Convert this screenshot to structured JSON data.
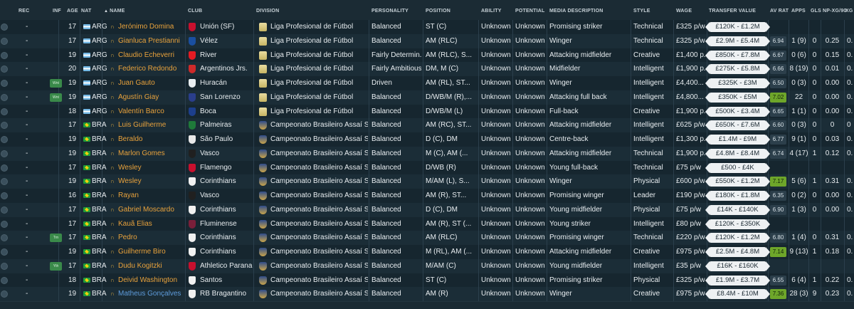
{
  "headers": {
    "rec": "REC",
    "inf": "INF",
    "age": "AGE",
    "nat": "NAT",
    "name": "NAME",
    "club": "CLUB",
    "division": "DIVISION",
    "personality": "PERSONALITY",
    "position": "POSITION",
    "ability": "ABILITY",
    "potential": "POTENTIAL",
    "media": "MEDIA DESCRIPTION",
    "style": "STYLE",
    "wage": "WAGE",
    "transfer_value": "TRANSFER VALUE",
    "av_rat": "AV RAT",
    "apps": "APPS",
    "gls": "GLS",
    "npxg": "NP-XG/90",
    "xg": "XG"
  },
  "colors": {
    "background": "#1a2a33",
    "name_orange": "#e8a23c",
    "name_blue": "#5e9cdc",
    "rating_good": "#6ea62a",
    "badge_green": "#3a8a4a"
  },
  "rows": [
    {
      "rec": "-",
      "inf": "",
      "age": "17",
      "nat": "ARG",
      "name": "Jerónimo Domina",
      "club": "Unión (SF)",
      "division": "Liga Profesional de Fútbol",
      "personality": "Balanced",
      "position": "ST (C)",
      "ability": "Unknown",
      "potential": "Unknown",
      "media": "Promising striker",
      "style": "Technical",
      "wage": "£325 p/w",
      "tv": "£120K - £1.2M",
      "avrat": "",
      "apps": "",
      "gls": "",
      "npxg": "",
      "xg": "",
      "crest": "#c8102e"
    },
    {
      "rec": "-",
      "inf": "",
      "age": "17",
      "nat": "ARG",
      "name": "Gianluca Prestianni",
      "club": "Vélez",
      "division": "Liga Profesional de Fútbol",
      "personality": "Balanced",
      "position": "AM (RLC)",
      "ability": "Unknown",
      "potential": "Unknown",
      "media": "Winger",
      "style": "Technical",
      "wage": "£325 p/w",
      "tv": "£2.9M - £5.4M",
      "avrat": "6.94",
      "apps": "1 (9)",
      "gls": "0",
      "npxg": "0.25",
      "xg": "0.",
      "crest": "#1a4fa0"
    },
    {
      "rec": "-",
      "inf": "",
      "age": "19",
      "nat": "ARG",
      "name": "Claudio Echeverri",
      "club": "River",
      "division": "Liga Profesional de Fútbol",
      "personality": "Fairly Determin...",
      "position": "AM (RLC), S...",
      "ability": "Unknown",
      "potential": "Unknown",
      "media": "Attacking midfielder",
      "style": "Creative",
      "wage": "£1,400 p...",
      "tv": "£850K - £7.8M",
      "avrat": "6.67",
      "apps": "0 (6)",
      "gls": "0",
      "npxg": "0.15",
      "xg": "0.",
      "crest": "#e41b23"
    },
    {
      "rec": "-",
      "inf": "",
      "age": "20",
      "nat": "ARG",
      "name": "Federico Redondo",
      "club": "Argentinos Jrs.",
      "division": "Liga Profesional de Fútbol",
      "personality": "Fairly Ambitious",
      "position": "DM, M (C)",
      "ability": "Unknown",
      "potential": "Unknown",
      "media": "Midfielder",
      "style": "Intelligent",
      "wage": "£1,900 p...",
      "tv": "£275K - £5.8M",
      "avrat": "6.66",
      "apps": "8 (19)",
      "gls": "0",
      "npxg": "0.01",
      "xg": "0.",
      "crest": "#cf2a2a"
    },
    {
      "rec": "-",
      "inf": "Wnt",
      "age": "19",
      "nat": "ARG",
      "name": "Juan Gauto",
      "club": "Huracán",
      "division": "Liga Profesional de Fútbol",
      "personality": "Driven",
      "position": "AM (RL), ST...",
      "ability": "Unknown",
      "potential": "Unknown",
      "media": "Winger",
      "style": "Intelligent",
      "wage": "£4,400...",
      "tv": "£325K - £3M",
      "avrat": "6.50",
      "apps": "0 (3)",
      "gls": "0",
      "npxg": "0.00",
      "xg": "0.",
      "crest": "#e9eef1"
    },
    {
      "rec": "-",
      "inf": "Wnt",
      "age": "19",
      "nat": "ARG",
      "name": "Agustín Giay",
      "club": "San Lorenzo",
      "division": "Liga Profesional de Fútbol",
      "personality": "Balanced",
      "position": "D/WB/M (R),...",
      "ability": "Unknown",
      "potential": "Unknown",
      "media": "Attacking full back",
      "style": "Intelligent",
      "wage": "£4,800...",
      "tv": "£350K - £5M",
      "avrat": "7.02",
      "apps": "22",
      "gls": "0",
      "npxg": "0.00",
      "xg": "0.",
      "crest": "#2a3e8c"
    },
    {
      "rec": "-",
      "inf": "",
      "age": "18",
      "nat": "ARG",
      "name": "Valentín Barco",
      "club": "Boca",
      "division": "Liga Profesional de Fútbol",
      "personality": "Balanced",
      "position": "D/WB/M (L)",
      "ability": "Unknown",
      "potential": "Unknown",
      "media": "Full-back",
      "style": "Creative",
      "wage": "£1,900 p...",
      "tv": "£500K - £3.4M",
      "avrat": "6.65",
      "apps": "1 (1)",
      "gls": "0",
      "npxg": "0.00",
      "xg": "0.",
      "crest": "#1d3f8c"
    },
    {
      "rec": "-",
      "inf": "",
      "age": "17",
      "nat": "BRA",
      "name": "Luis Guilherme",
      "club": "Palmeiras",
      "division": "Campeonato Brasileiro Assaí Sé...",
      "personality": "Balanced",
      "position": "AM (RC), ST...",
      "ability": "Unknown",
      "potential": "Unknown",
      "media": "Attacking midfielder",
      "style": "Intelligent",
      "wage": "£625 p/w",
      "tv": "£650K - £7.6M",
      "avrat": "6.60",
      "apps": "0 (3)",
      "gls": "0",
      "npxg": "0",
      "xg": "0",
      "crest": "#1f7a3a"
    },
    {
      "rec": "-",
      "inf": "",
      "age": "19",
      "nat": "BRA",
      "name": "Beraldo",
      "club": "São Paulo",
      "division": "Campeonato Brasileiro Assaí Sé...",
      "personality": "Balanced",
      "position": "D (C), DM",
      "ability": "Unknown",
      "potential": "Unknown",
      "media": "Centre-back",
      "style": "Intelligent",
      "wage": "£1,300 p...",
      "tv": "£1.4M - £9M",
      "avrat": "6.77",
      "apps": "9 (1)",
      "gls": "0",
      "npxg": "0.03",
      "xg": "0.",
      "crest": "#e8e8e8"
    },
    {
      "rec": "-",
      "inf": "",
      "age": "19",
      "nat": "BRA",
      "name": "Marlon Gomes",
      "club": "Vasco",
      "division": "Campeonato Brasileiro Assaí Sé...",
      "personality": "Balanced",
      "position": "M (C), AM (...",
      "ability": "Unknown",
      "potential": "Unknown",
      "media": "Attacking midfielder",
      "style": "Technical",
      "wage": "£1,900 p...",
      "tv": "£4.8M - £8.4M",
      "avrat": "6.74",
      "apps": "4 (17)",
      "gls": "1",
      "npxg": "0.12",
      "xg": "0.",
      "crest": "#202020"
    },
    {
      "rec": "-",
      "inf": "",
      "age": "17",
      "nat": "BRA",
      "name": "Wesley",
      "club": "Flamengo",
      "division": "Campeonato Brasileiro Assaí Sé...",
      "personality": "Balanced",
      "position": "D/WB (R)",
      "ability": "Unknown",
      "potential": "Unknown",
      "media": "Young full-back",
      "style": "Technical",
      "wage": "£75 p/w",
      "tv": "£500 - £4K",
      "avrat": "",
      "apps": "",
      "gls": "",
      "npxg": "",
      "xg": "",
      "crest": "#c8102e"
    },
    {
      "rec": "-",
      "inf": "",
      "age": "19",
      "nat": "BRA",
      "name": "Wesley",
      "club": "Corinthians",
      "division": "Campeonato Brasileiro Assaí Sé...",
      "personality": "Balanced",
      "position": "M/AM (L), S...",
      "ability": "Unknown",
      "potential": "Unknown",
      "media": "Winger",
      "style": "Physical",
      "wage": "£600 p/w",
      "tv": "£550K - £1.2M",
      "avrat": "7.17",
      "apps": "5 (6)",
      "gls": "1",
      "npxg": "0.31",
      "xg": "0.",
      "crest": "#f1f1f1"
    },
    {
      "rec": "-",
      "inf": "",
      "age": "16",
      "nat": "BRA",
      "name": "Rayan",
      "club": "Vasco",
      "division": "Campeonato Brasileiro Assaí Sé...",
      "personality": "Balanced",
      "position": "AM (R), ST...",
      "ability": "Unknown",
      "potential": "Unknown",
      "media": "Promising winger",
      "style": "Leader",
      "wage": "£190 p/w",
      "tv": "£180K - £1.8M",
      "avrat": "6.35",
      "apps": "0 (2)",
      "gls": "0",
      "npxg": "0.00",
      "xg": "0.",
      "crest": "#202020"
    },
    {
      "rec": "-",
      "inf": "",
      "age": "17",
      "nat": "BRA",
      "name": "Gabriel Moscardo",
      "club": "Corinthians",
      "division": "Campeonato Brasileiro Assaí Sé...",
      "personality": "Balanced",
      "position": "D (C), DM",
      "ability": "Unknown",
      "potential": "Unknown",
      "media": "Young midfielder",
      "style": "Physical",
      "wage": "£75 p/w",
      "tv": "£14K - £140K",
      "avrat": "6.90",
      "apps": "1 (3)",
      "gls": "0",
      "npxg": "0.00",
      "xg": "0.",
      "crest": "#f1f1f1"
    },
    {
      "rec": "-",
      "inf": "",
      "age": "17",
      "nat": "BRA",
      "name": "Kauã Elias",
      "club": "Fluminense",
      "division": "Campeonato Brasileiro Assaí Sé...",
      "personality": "Balanced",
      "position": "AM (R), ST (...",
      "ability": "Unknown",
      "potential": "Unknown",
      "media": "Young striker",
      "style": "Intelligent",
      "wage": "£80 p/w",
      "tv": "£120K - £350K",
      "avrat": "",
      "apps": "",
      "gls": "",
      "npxg": "",
      "xg": "",
      "crest": "#7a1f3a"
    },
    {
      "rec": "-",
      "inf": "Trn",
      "age": "17",
      "nat": "BRA",
      "name": "Pedro",
      "club": "Corinthians",
      "division": "Campeonato Brasileiro Assaí Sé...",
      "personality": "Balanced",
      "position": "AM (RLC)",
      "ability": "Unknown",
      "potential": "Unknown",
      "media": "Promising winger",
      "style": "Technical",
      "wage": "£220 p/w",
      "tv": "£120K - £1.2M",
      "avrat": "6.80",
      "apps": "1 (4)",
      "gls": "0",
      "npxg": "0.31",
      "xg": "0.",
      "crest": "#f1f1f1"
    },
    {
      "rec": "-",
      "inf": "",
      "age": "19",
      "nat": "BRA",
      "name": "Guilherme Biro",
      "club": "Corinthians",
      "division": "Campeonato Brasileiro Assaí Sé...",
      "personality": "Balanced",
      "position": "M (RL), AM (...",
      "ability": "Unknown",
      "potential": "Unknown",
      "media": "Attacking midfielder",
      "style": "Creative",
      "wage": "£975 p/w",
      "tv": "£2.5M - £4.8M",
      "avrat": "7.14",
      "apps": "9 (13)",
      "gls": "1",
      "npxg": "0.18",
      "xg": "0.",
      "crest": "#f1f1f1"
    },
    {
      "rec": "-",
      "inf": "Yth",
      "age": "17",
      "nat": "BRA",
      "name": "Dudu Kogitzki",
      "club": "Athletico Parana...",
      "division": "Campeonato Brasileiro Assaí Sé...",
      "personality": "Balanced",
      "position": "M/AM (C)",
      "ability": "Unknown",
      "potential": "Unknown",
      "media": "Young midfielder",
      "style": "Intelligent",
      "wage": "£35 p/w",
      "tv": "£16K - £160K",
      "avrat": "",
      "apps": "",
      "gls": "",
      "npxg": "",
      "xg": "",
      "crest": "#c8102e"
    },
    {
      "rec": "-",
      "inf": "",
      "age": "18",
      "nat": "BRA",
      "name": "Deivid Washington",
      "club": "Santos",
      "division": "Campeonato Brasileiro Assaí Sé...",
      "personality": "Balanced",
      "position": "ST (C)",
      "ability": "Unknown",
      "potential": "Unknown",
      "media": "Promising striker",
      "style": "Physical",
      "wage": "£325 p/w",
      "tv": "£1.9M - £3.7M",
      "avrat": "6.55",
      "apps": "6 (4)",
      "gls": "1",
      "npxg": "0.22",
      "xg": "0.",
      "crest": "#f1f1f1"
    },
    {
      "rec": "-",
      "inf": "",
      "age": "19",
      "nat": "BRA",
      "name": "Matheus Gonçalves",
      "club": "RB Bragantino",
      "division": "Campeonato Brasileiro Assaí Sé...",
      "personality": "Balanced",
      "position": "AM (R)",
      "ability": "Unknown",
      "potential": "Unknown",
      "media": "Winger",
      "style": "Creative",
      "wage": "£975 p/w",
      "tv": "£8.4M - £10M",
      "avrat": "7.36",
      "apps": "28 (3)",
      "gls": "9",
      "npxg": "0.23",
      "xg": "0.",
      "crest": "#f1f1f1",
      "blue": true
    }
  ]
}
